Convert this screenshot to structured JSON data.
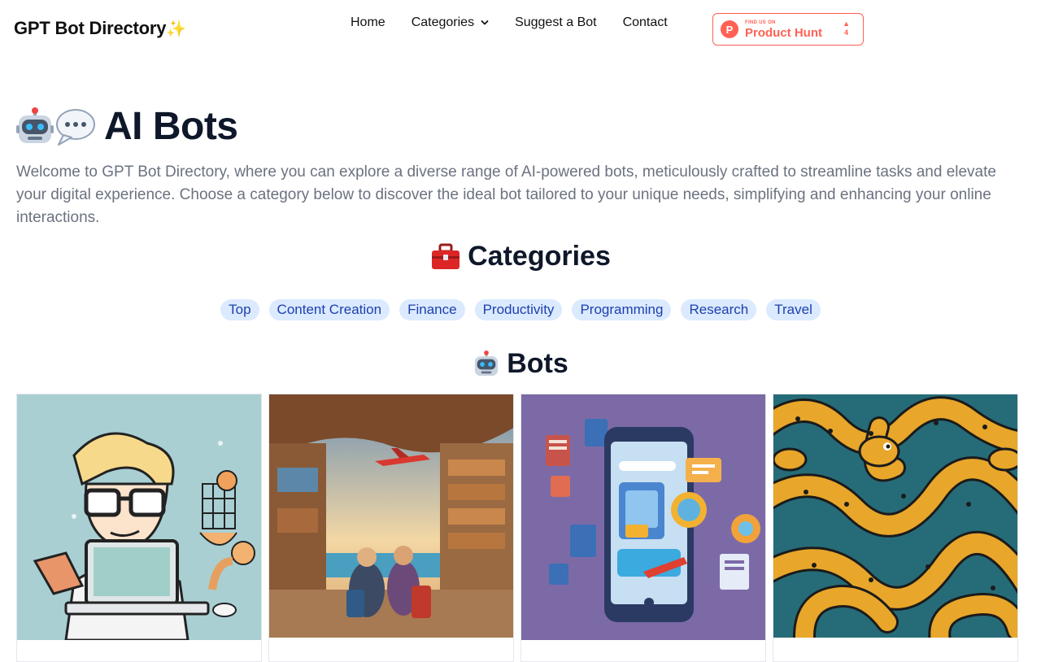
{
  "nav": {
    "brand": "GPT Bot Directory",
    "links": [
      {
        "label": "Home"
      },
      {
        "label": "Categories"
      },
      {
        "label": "Suggest a Bot"
      },
      {
        "label": "Contact"
      }
    ],
    "product_hunt": {
      "small": "FIND US ON",
      "big": "Product Hunt",
      "count": "4"
    }
  },
  "hero": {
    "title": "AI Bots",
    "description": "Welcome to GPT Bot Directory, where you can explore a diverse range of AI-powered bots, meticulously crafted to streamline tasks and elevate your digital experience. Choose a category below to discover the ideal bot tailored to your unique needs, simplifying and enhancing your online interactions."
  },
  "categories": {
    "title": "Categories",
    "items": [
      "Top",
      "Content Creation",
      "Finance",
      "Productivity",
      "Programming",
      "Research",
      "Travel"
    ]
  },
  "bots": {
    "title": "Bots",
    "cards": [
      {
        "image": "developer-illustration"
      },
      {
        "image": "travel-market-illustration"
      },
      {
        "image": "mobile-apps-illustration"
      },
      {
        "image": "snakes-pattern-illustration"
      }
    ]
  },
  "colors": {
    "chip_bg": "#dbeafe",
    "chip_text": "#1e40af",
    "product_hunt": "#ff6154"
  }
}
